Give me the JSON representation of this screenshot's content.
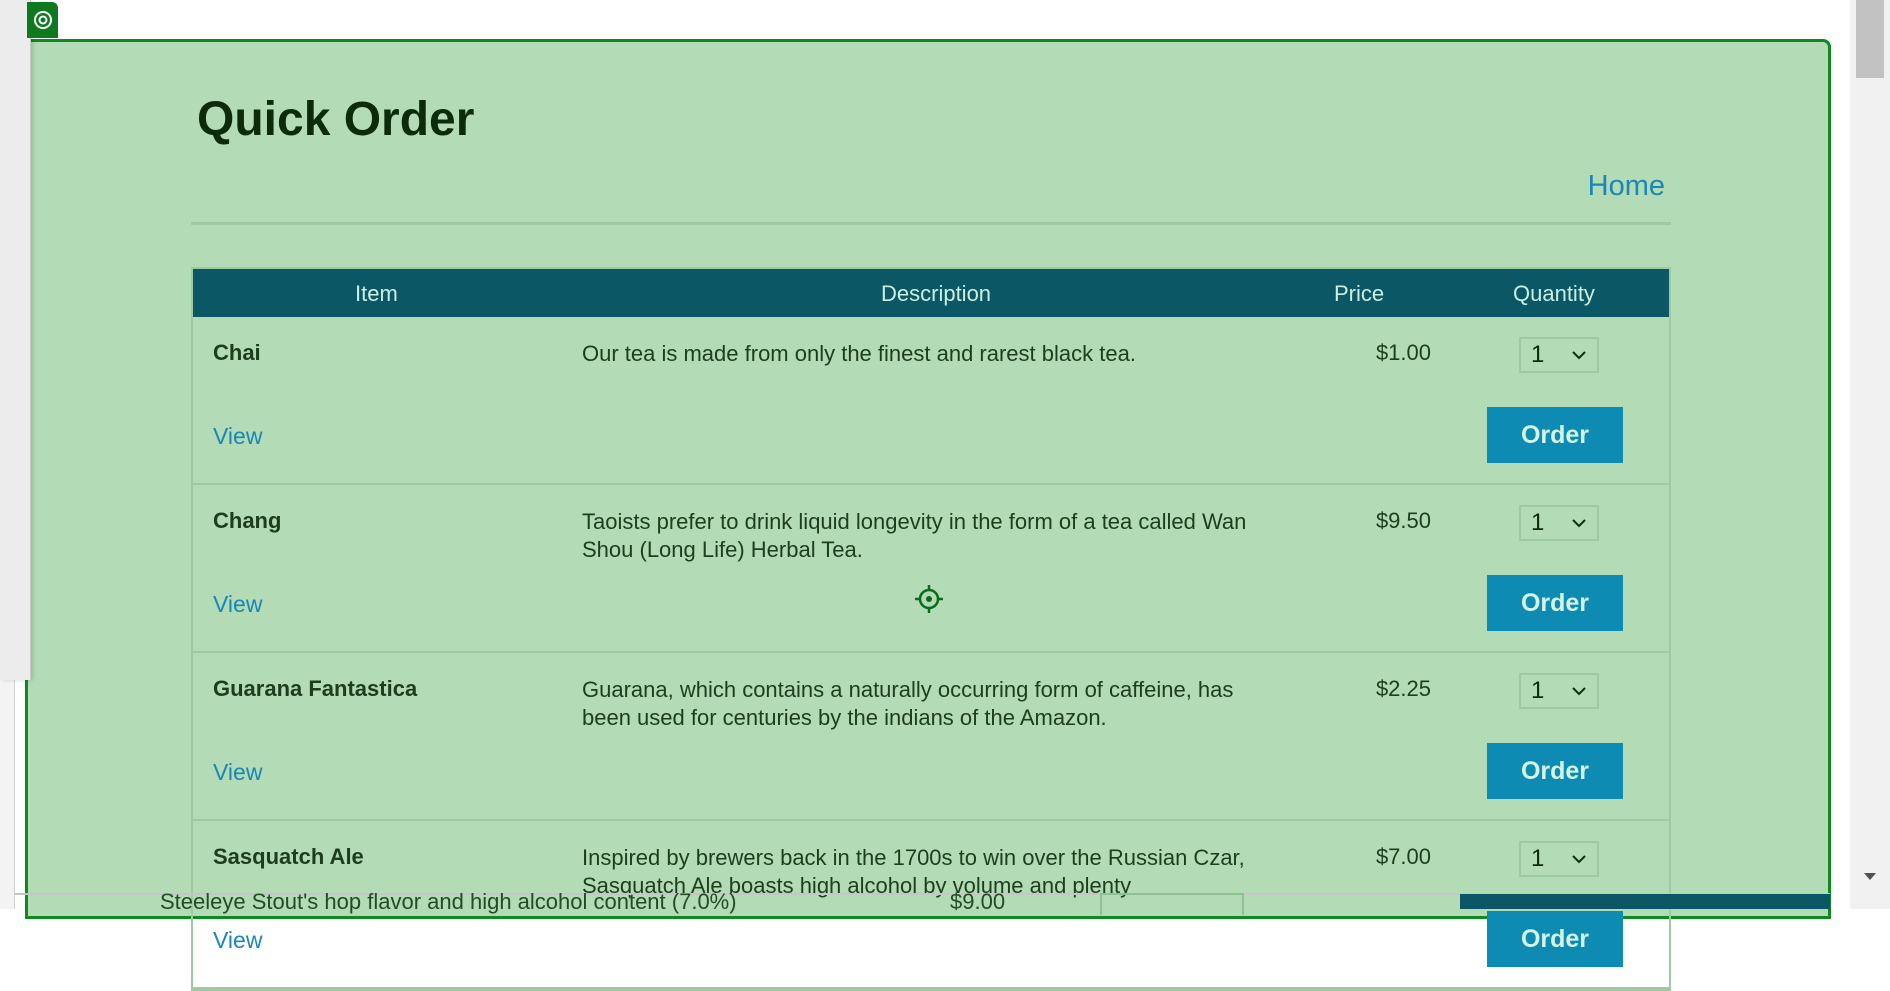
{
  "page": {
    "title": "Quick Order",
    "home_link": "Home"
  },
  "table": {
    "headers": {
      "item": "Item",
      "description": "Description",
      "price": "Price",
      "quantity": "Quantity"
    },
    "rows": [
      {
        "name": "Chai",
        "description": "Our tea is made from only the finest and rarest black tea.",
        "price": "$1.00",
        "quantity": "1",
        "view_label": "View",
        "order_label": "Order"
      },
      {
        "name": "Chang",
        "description": "Taoists prefer to drink liquid longevity in the form of a tea called Wan Shou (Long Life) Herbal Tea.",
        "price": "$9.50",
        "quantity": "1",
        "view_label": "View",
        "order_label": "Order"
      },
      {
        "name": "Guarana Fantastica",
        "description": "Guarana, which contains a naturally occurring form of caffeine, has been used for centuries by the indians of the Amazon.",
        "price": "$2.25",
        "quantity": "1",
        "view_label": "View",
        "order_label": "Order"
      },
      {
        "name": "Sasquatch Ale",
        "description": "Inspired by brewers back in the 1700s to win over the Russian Czar, Sasquatch Ale boasts high alcohol by volume and plenty",
        "price": "$7.00",
        "quantity": "1",
        "view_label": "View",
        "order_label": "Order"
      }
    ]
  },
  "overlay": {
    "text": "Steeleye Stout's hop flavor and high alcohol content (7.0%)",
    "price": "$9.00"
  },
  "colors": {
    "frame_bg": "#b3dbb5",
    "frame_border": "#0f8a1e",
    "header_bg": "#0b5766",
    "link": "#1a87b8",
    "button_bg": "#0e8bb3"
  },
  "icons": [
    "target-icon",
    "crosshair-cursor-icon",
    "chevron-down-icon",
    "scroll-down-arrow-icon"
  ]
}
